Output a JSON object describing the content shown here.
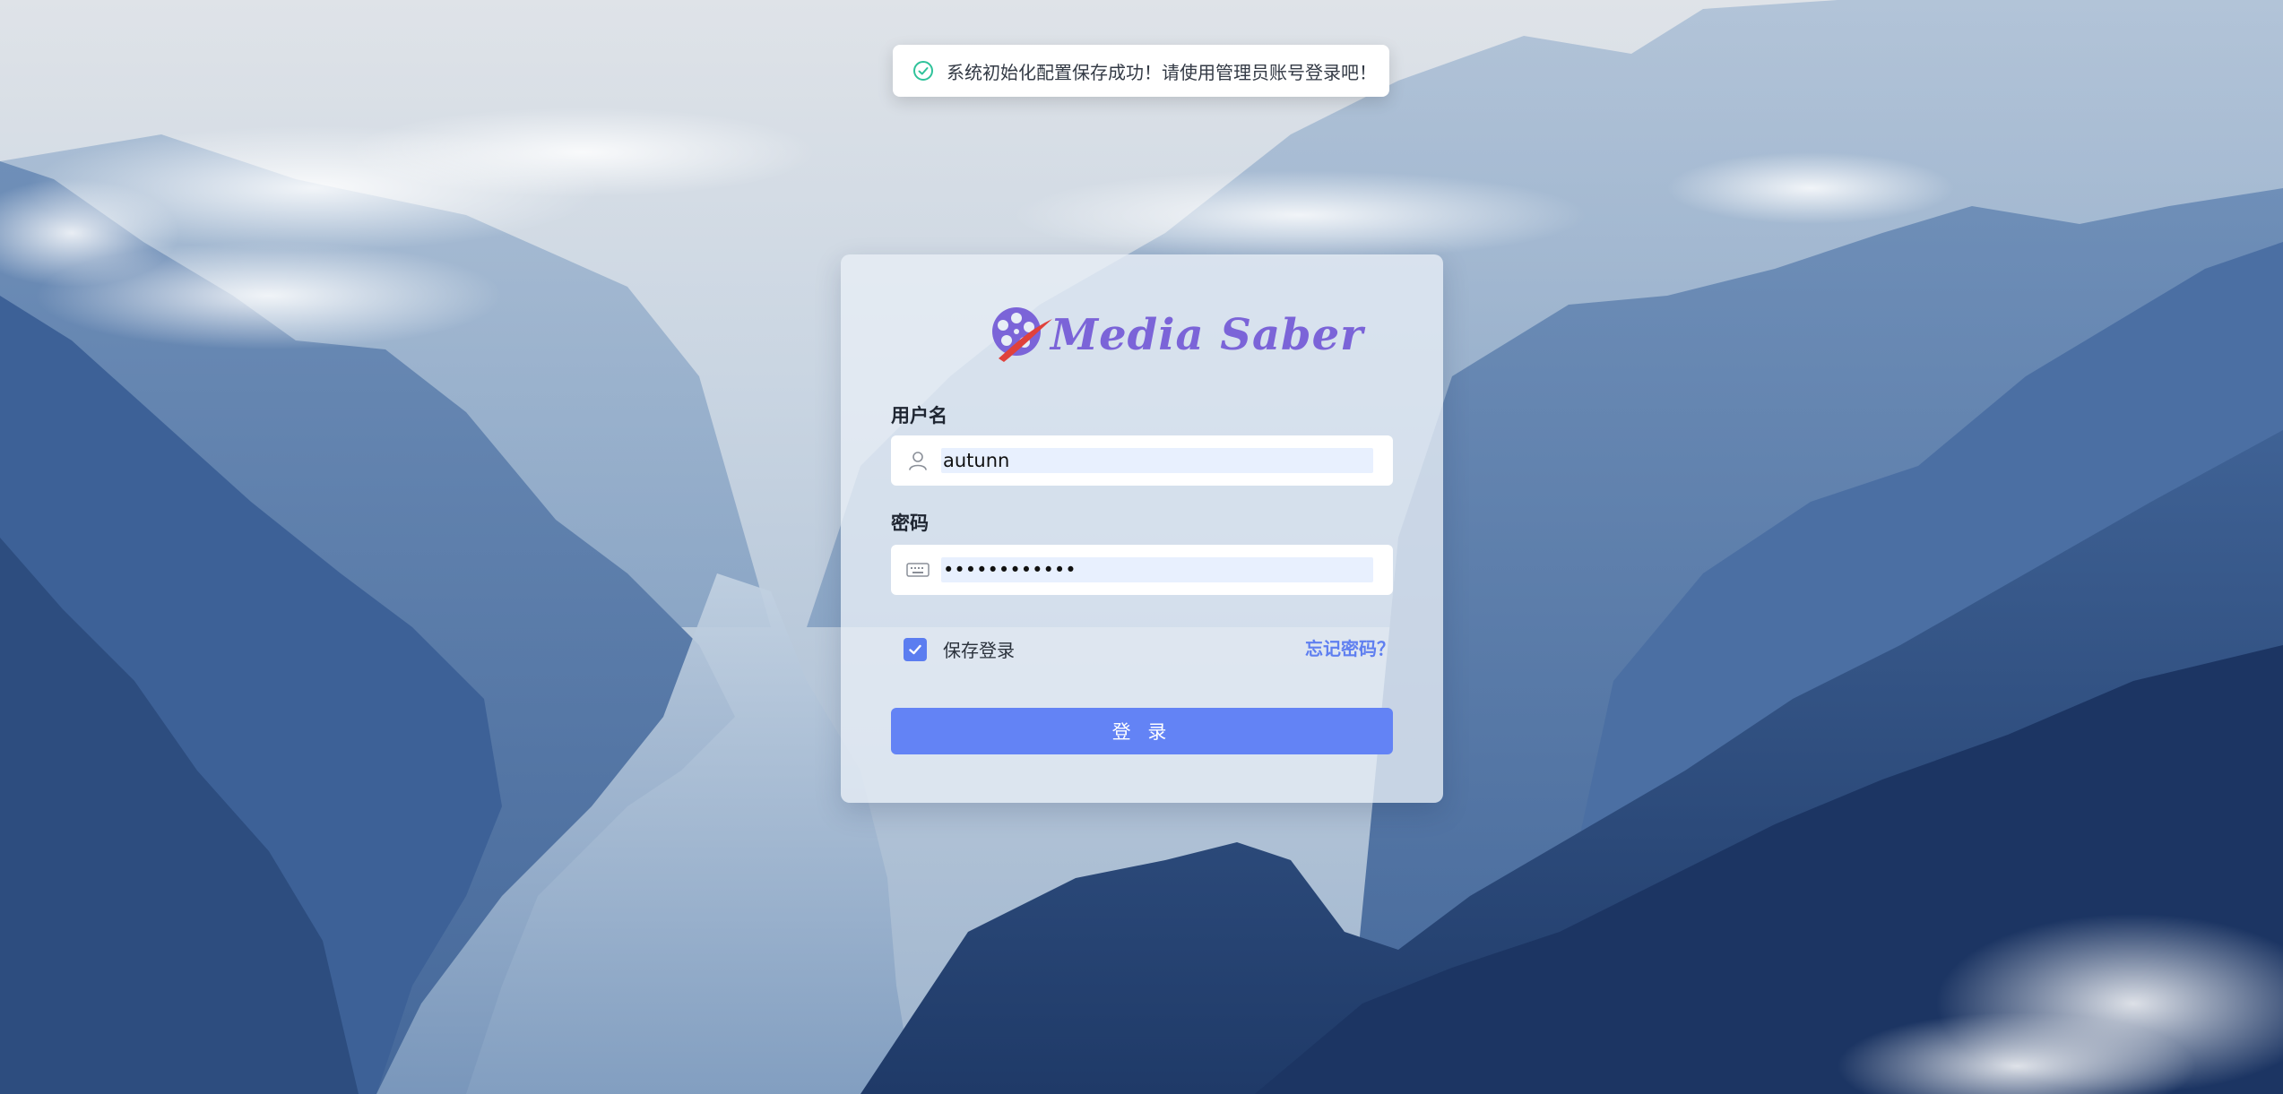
{
  "toast": {
    "message": "系统初始化配置保存成功！请使用管理员账号登录吧！",
    "icon": "check-circle-icon",
    "accent": "#2fc29a"
  },
  "login": {
    "brand": "Media Saber",
    "username_label": "用户名",
    "username_value": "autunn",
    "password_label": "密码",
    "password_value": "••••••••••••",
    "remember_label": "保存登录",
    "remember_checked": true,
    "forgot_label": "忘记密码？",
    "submit_label": "登 录",
    "accent": "#6383f5",
    "brand_color": "#7b64d8"
  }
}
